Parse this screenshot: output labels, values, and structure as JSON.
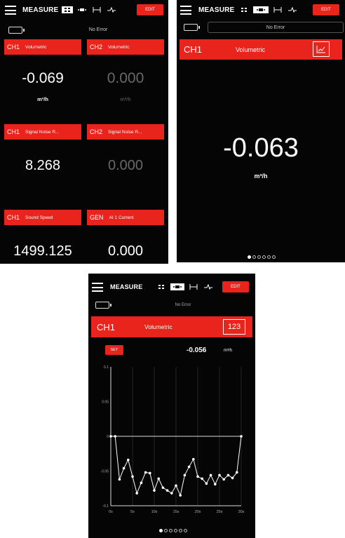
{
  "app": {
    "title": "MEASURE",
    "edit_label": "EDIT",
    "status": "No Error"
  },
  "screen1": {
    "tiles": [
      {
        "channel": "CH1",
        "name": "Volumetric",
        "value": "-0.069",
        "unit": "m³/h",
        "active": true
      },
      {
        "channel": "CH2",
        "name": "Volumetric",
        "value": "0.000",
        "unit": "m³/h",
        "active": false
      },
      {
        "channel": "CH1",
        "name": "Signal Noise R...",
        "value": "8.268",
        "unit": "",
        "active": true
      },
      {
        "channel": "CH2",
        "name": "Signal Noise R...",
        "value": "0.000",
        "unit": "",
        "active": false
      },
      {
        "channel": "CH1",
        "name": "Sound Speed",
        "value": "1499.125",
        "unit": "",
        "active": true
      },
      {
        "channel": "GEN",
        "name": "AI 1 Current",
        "value": "0.000",
        "unit": "",
        "active": true
      }
    ]
  },
  "screen2": {
    "channel": "CH1",
    "name": "Volumetric",
    "value": "-0.063",
    "unit": "m³/h",
    "page_dots": 6,
    "active_dot": 0
  },
  "screen3": {
    "channel": "CH1",
    "name": "Volumetric",
    "toggle_label": "123",
    "set_label": "SET",
    "value": "-0.056",
    "unit": "m³/h",
    "page_dots": 6,
    "active_dot": 0,
    "chart_data": {
      "type": "line",
      "x_ticks": [
        "0s",
        "5s",
        "10s",
        "15s",
        "20s",
        "25s",
        "30s"
      ],
      "y_ticks": [
        "0.1",
        "0.05",
        "0",
        "-0.05",
        "-0.1"
      ],
      "ylim": [
        -0.1,
        0.1
      ],
      "xlim": [
        0,
        30
      ],
      "grid": true,
      "series": [
        {
          "color": "#ffffff",
          "x": [
            0,
            1,
            2,
            3,
            4,
            5,
            6,
            7,
            8,
            9,
            10,
            11,
            12,
            13,
            14,
            15,
            16,
            17,
            18,
            19,
            20,
            21,
            22,
            23,
            24,
            25,
            26,
            27,
            28,
            29,
            30
          ],
          "values": [
            0,
            0,
            -0.062,
            -0.046,
            -0.034,
            -0.058,
            -0.082,
            -0.067,
            -0.052,
            -0.053,
            -0.078,
            -0.061,
            -0.074,
            -0.078,
            -0.082,
            -0.071,
            -0.085,
            -0.056,
            -0.044,
            -0.033,
            -0.058,
            -0.061,
            -0.068,
            -0.056,
            -0.069,
            -0.056,
            -0.062,
            -0.056,
            -0.06,
            -0.052,
            0
          ]
        }
      ]
    }
  }
}
